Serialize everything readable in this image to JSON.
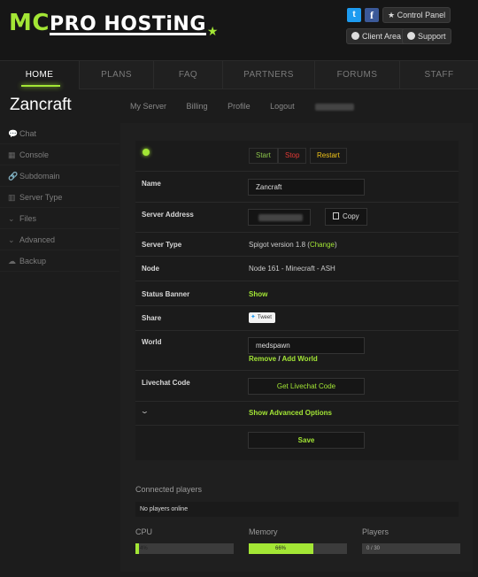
{
  "header": {
    "logo_mc": "MC",
    "logo_rest": "PRO HOSTiNG",
    "twitter_glyph": "t",
    "facebook_glyph": "f",
    "control_panel": "Control Panel",
    "client_area": "Client Area",
    "support": "Support"
  },
  "nav": [
    "HOME",
    "PLANS",
    "FAQ",
    "PARTNERS",
    "FORUMS",
    "STAFF"
  ],
  "server_name": "Zancraft",
  "subnav": {
    "my_server": "My Server",
    "billing": "Billing",
    "profile": "Profile",
    "logout": "Logout"
  },
  "sidebar": [
    {
      "label": "Chat",
      "icon": "chat-icon",
      "glyph": "💬"
    },
    {
      "label": "Console",
      "icon": "console-icon",
      "glyph": "▦"
    },
    {
      "label": "Subdomain",
      "icon": "link-icon",
      "glyph": "🔗"
    },
    {
      "label": "Server Type",
      "icon": "server-type-icon",
      "glyph": "▥"
    },
    {
      "label": "Files",
      "icon": "chevron-down-icon",
      "glyph": "⌄"
    },
    {
      "label": "Advanced",
      "icon": "chevron-down-icon",
      "glyph": "⌄"
    },
    {
      "label": "Backup",
      "icon": "cloud-icon",
      "glyph": "☁"
    }
  ],
  "controls": {
    "start": "Start",
    "stop": "Stop",
    "restart": "Restart"
  },
  "form": {
    "name_label": "Name",
    "name_value": "Zancraft",
    "address_label": "Server Address",
    "copy": "Copy",
    "type_label": "Server Type",
    "type_value": "Spigot version 1.8",
    "type_change": "Change",
    "node_label": "Node",
    "node_value": "Node 161 - Minecraft - ASH",
    "banner_label": "Status Banner",
    "banner_value": "Show",
    "share_label": "Share",
    "tweet": "Tweet",
    "world_label": "World",
    "world_value": "medspawn",
    "world_remove": "Remove",
    "world_sep": " / ",
    "world_add": "Add World",
    "livechat_label": "Livechat Code",
    "livechat_button": "Get Livechat Code",
    "advanced_toggle": "Show Advanced Options",
    "save": "Save"
  },
  "players": {
    "title": "Connected players",
    "empty": "No players online"
  },
  "stats": {
    "cpu_label": "CPU",
    "cpu_text": "4%",
    "cpu_fraction": 0.04,
    "memory_label": "Memory",
    "memory_text": "66%",
    "memory_fraction": 0.66,
    "players_label": "Players",
    "players_text": "0 / 30",
    "players_fraction": 0
  },
  "colors": {
    "accent": "#a3e635",
    "stop": "#e53935",
    "restart": "#f0c419"
  }
}
